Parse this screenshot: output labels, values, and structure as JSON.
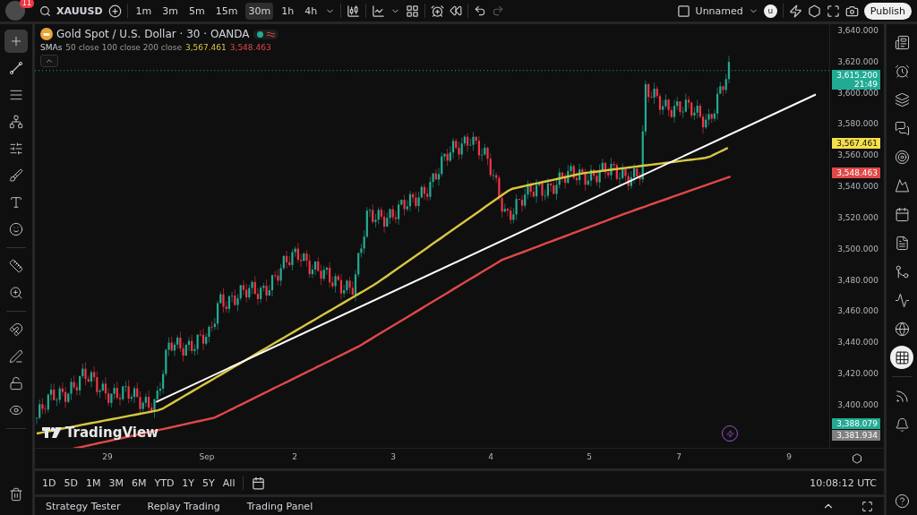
{
  "header": {
    "avatar_badge": "11",
    "symbol": "XAUUSD",
    "intervals": [
      {
        "label": "1m",
        "selected": false
      },
      {
        "label": "3m",
        "selected": false
      },
      {
        "label": "5m",
        "selected": false
      },
      {
        "label": "15m",
        "selected": false
      },
      {
        "label": "30m",
        "selected": true
      },
      {
        "label": "1h",
        "selected": false
      },
      {
        "label": "4h",
        "selected": false
      }
    ],
    "layout_name": "Unnamed",
    "user_initial": "u",
    "publish": "Publish"
  },
  "left_toolbar": {
    "groups": [
      {
        "tools": [
          {
            "selected": true
          },
          {
            "selected": false
          },
          {
            "selected": false
          },
          {
            "selected": false
          },
          {
            "selected": false
          },
          {
            "selected": false
          },
          {
            "selected": false
          },
          {
            "selected": false
          }
        ]
      },
      {
        "tools": [
          {
            "selected": false
          },
          {
            "selected": false
          }
        ]
      },
      {
        "tools": [
          {
            "selected": false
          },
          {
            "selected": false
          },
          {
            "selected": false
          },
          {
            "selected": false
          }
        ]
      },
      {
        "tools": [
          {
            "selected": false
          }
        ]
      }
    ]
  },
  "legend": {
    "title": "Gold Spot / U.S. Dollar · 30 · OANDA",
    "indicator_name": "SMAs",
    "indicator_params": "50 close 100 close 200 close",
    "values": [
      {
        "text": "3,567.461",
        "color": "#d8c640"
      },
      {
        "text": "3,548.463",
        "color": "#e04848"
      }
    ]
  },
  "price_axis": {
    "ticks": [
      "3,640.000",
      "3,620.000",
      "3,600.000",
      "3,580.000",
      "3,560.000",
      "3,540.000",
      "3,520.000",
      "3,500.000",
      "3,480.000",
      "3,460.000",
      "3,440.000",
      "3,420.000",
      "3,400.000"
    ],
    "badges": [
      {
        "value": "3,615.200",
        "countdown": "21:49",
        "color": "#22ab94"
      },
      {
        "value": "3,567.461",
        "color": "#f5e04a"
      },
      {
        "value": "3,548.463",
        "color": "#e04848"
      },
      {
        "value": "3,388.079",
        "color": "#22ab94"
      },
      {
        "value": "3,381.934",
        "color": "#808080"
      }
    ]
  },
  "time_axis": {
    "labels": [
      "29",
      "Sep",
      "2",
      "3",
      "4",
      "5",
      "7",
      "9"
    ]
  },
  "brand": "TradingView",
  "range_bar": {
    "ranges": [
      "1D",
      "5D",
      "1M",
      "3M",
      "6M",
      "YTD",
      "1Y",
      "5Y",
      "All"
    ],
    "clock": "10:08:12 UTC"
  },
  "bottom_tabs": [
    "Strategy Tester",
    "Replay Trading",
    "Trading Panel"
  ],
  "right_sidebar": {
    "groups": [
      {
        "items": [
          {
            "selected": false
          },
          {
            "selected": false
          },
          {
            "selected": false
          },
          {
            "selected": false
          },
          {
            "selected": false
          },
          {
            "selected": false
          },
          {
            "selected": false
          },
          {
            "selected": false
          },
          {
            "selected": false
          },
          {
            "selected": false
          },
          {
            "selected": false
          },
          {
            "selected": true
          }
        ]
      },
      {
        "items": [
          {
            "selected": false
          },
          {
            "selected": false
          }
        ]
      },
      {
        "items": [
          {
            "selected": false
          }
        ]
      }
    ]
  }
}
